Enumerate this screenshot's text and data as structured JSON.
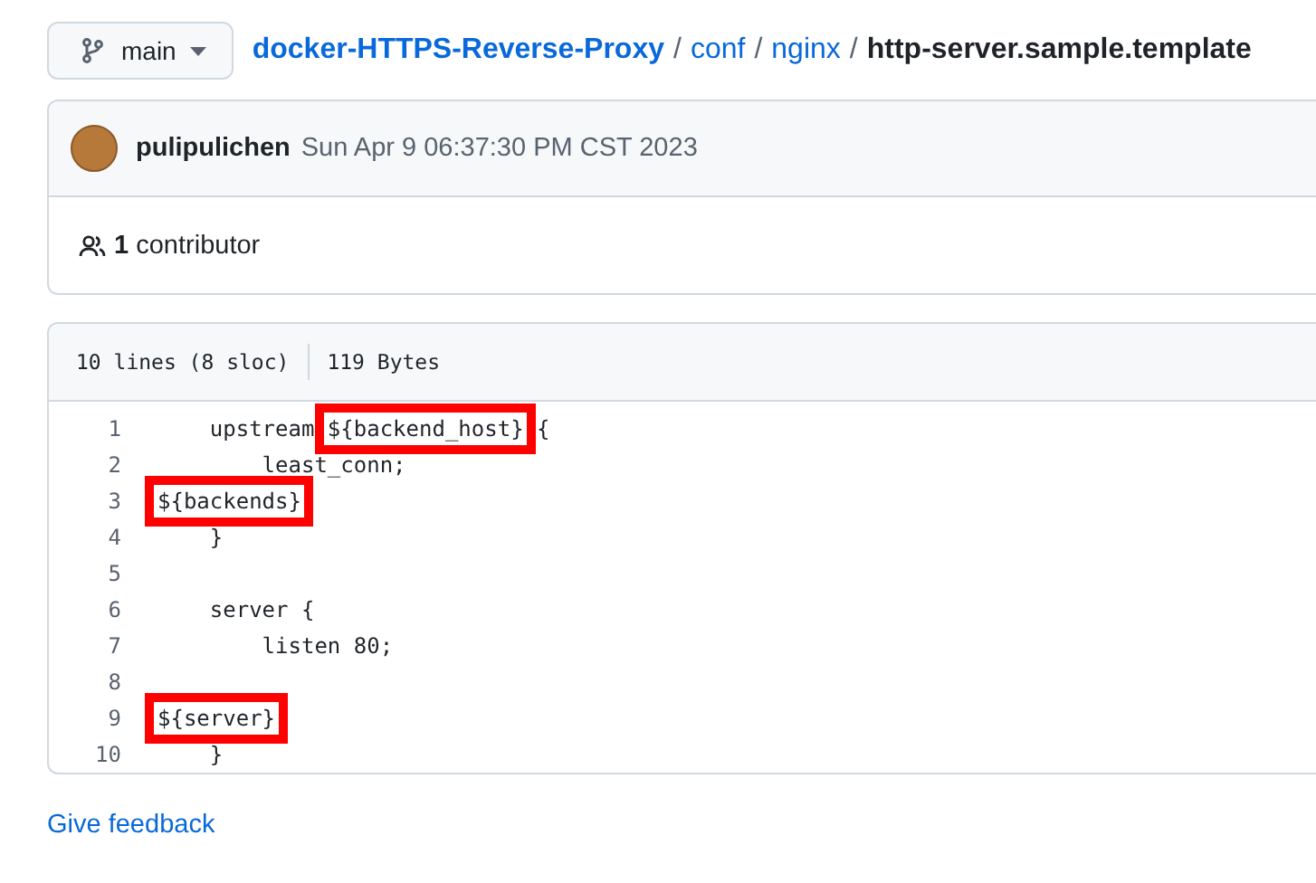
{
  "branch": {
    "label": "main"
  },
  "breadcrumb": {
    "links": [
      "docker-HTTPS-Reverse-Proxy",
      "conf",
      "nginx"
    ],
    "separators": [
      "/",
      "/",
      "/"
    ],
    "current": "http-server.sample.template"
  },
  "commit": {
    "author": "pulipulichen",
    "date": "Sun Apr 9 06:37:30 PM CST 2023"
  },
  "contributors": {
    "count": "1",
    "label": "contributor"
  },
  "file_info": {
    "lines": "10 lines (8 sloc)",
    "size": "119 Bytes"
  },
  "code_lines": [
    {
      "number": "1",
      "segments": [
        {
          "text": "    upstream ",
          "highlighted": false
        },
        {
          "text": "${backend_host}",
          "highlighted": true
        },
        {
          "text": " {",
          "highlighted": false
        }
      ]
    },
    {
      "number": "2",
      "segments": [
        {
          "text": "        least_conn;",
          "highlighted": false
        }
      ]
    },
    {
      "number": "3",
      "segments": [
        {
          "text": "${backends}",
          "highlighted": true
        }
      ]
    },
    {
      "number": "4",
      "segments": [
        {
          "text": "    }",
          "highlighted": false
        }
      ]
    },
    {
      "number": "5"
    },
    {
      "number": "6",
      "segments": [
        {
          "text": "    server {",
          "highlighted": false
        }
      ]
    },
    {
      "number": "7",
      "segments": [
        {
          "text": "        listen 80;",
          "highlighted": false
        }
      ]
    },
    {
      "number": "8"
    },
    {
      "number": "9",
      "segments": [
        {
          "text": "${server}",
          "highlighted": true
        }
      ]
    },
    {
      "number": "10",
      "segments": [
        {
          "text": "    }",
          "highlighted": false
        }
      ]
    }
  ],
  "feedback_link": "Give feedback"
}
